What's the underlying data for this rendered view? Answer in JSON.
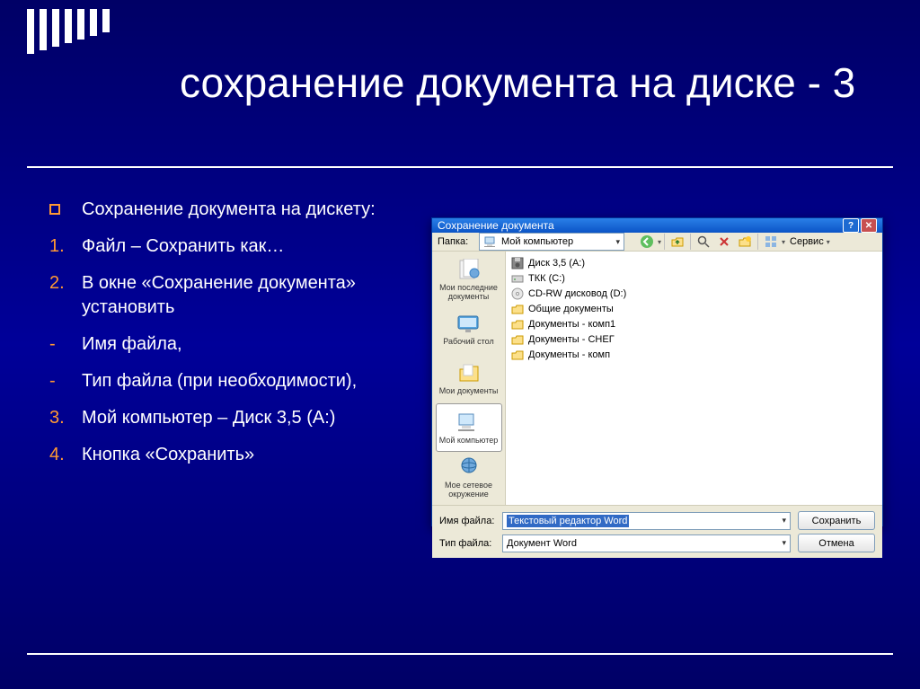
{
  "slide": {
    "title": "сохранение документа на диске - 3",
    "intro": "Сохранение документа на дискету:",
    "steps": [
      "Файл – Сохранить как…",
      "В окне «Сохранение документа» установить",
      "Мой компьютер – Диск 3,5 (A:)",
      "Кнопка «Сохранить»"
    ],
    "dashes": [
      "Имя файла,",
      "Тип файла (при необходимости),"
    ]
  },
  "dialog": {
    "title": "Сохранение документа",
    "folder_label": "Папка:",
    "folder_value": "Мой компьютер",
    "tools_label": "Сервис",
    "places": [
      {
        "label": "Мои последние документы"
      },
      {
        "label": "Рабочий стол"
      },
      {
        "label": "Мои документы"
      },
      {
        "label": "Мой компьютер"
      },
      {
        "label": "Мое сетевое окружение"
      }
    ],
    "files": [
      {
        "name": "Диск 3,5 (A:)",
        "icon": "floppy"
      },
      {
        "name": "ТКК (C:)",
        "icon": "hdd"
      },
      {
        "name": "CD-RW дисковод (D:)",
        "icon": "cd"
      },
      {
        "name": "Общие документы",
        "icon": "folder"
      },
      {
        "name": "Документы - комп1",
        "icon": "folder"
      },
      {
        "name": "Документы - СНЕГ",
        "icon": "folder"
      },
      {
        "name": "Документы - комп",
        "icon": "folder"
      }
    ],
    "filename_label": "Имя файла:",
    "filename_value": "Текстовый редактор Word",
    "filetype_label": "Тип файла:",
    "filetype_value": "Документ Word",
    "save_btn": "Сохранить",
    "cancel_btn": "Отмена"
  }
}
